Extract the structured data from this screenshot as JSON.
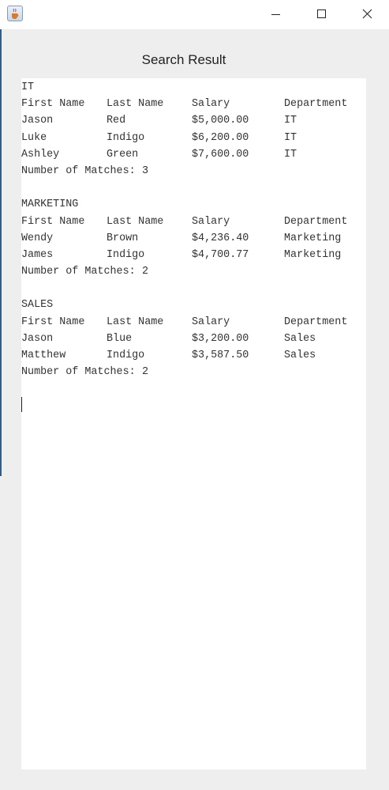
{
  "window": {
    "icon": "java-cup-icon",
    "controls": [
      "minimize",
      "maximize",
      "close"
    ]
  },
  "title": "Search Result",
  "headers": [
    "First Name",
    "Last Name",
    "Salary",
    "Department"
  ],
  "match_label": "Number of Matches: ",
  "groups": [
    {
      "name": "IT",
      "rows": [
        [
          "Jason",
          "Red",
          "$5,000.00",
          "IT"
        ],
        [
          "Luke",
          "Indigo",
          "$6,200.00",
          "IT"
        ],
        [
          "Ashley",
          "Green",
          "$7,600.00",
          "IT"
        ]
      ],
      "matches": "3"
    },
    {
      "name": "MARKETING",
      "rows": [
        [
          "Wendy",
          "Brown",
          "$4,236.40",
          "Marketing"
        ],
        [
          "James",
          "Indigo",
          "$4,700.77",
          "Marketing"
        ]
      ],
      "matches": "2"
    },
    {
      "name": "SALES",
      "rows": [
        [
          "Jason",
          "Blue",
          "$3,200.00",
          "Sales"
        ],
        [
          "Matthew",
          "Indigo",
          "$3,587.50",
          "Sales"
        ]
      ],
      "matches": "2"
    }
  ]
}
